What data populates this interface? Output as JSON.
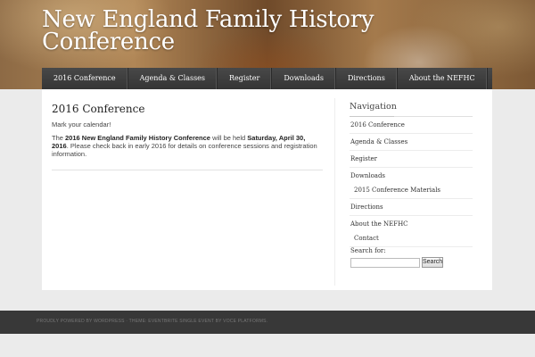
{
  "site": {
    "title": "New England Family History Conference"
  },
  "nav": {
    "items": [
      {
        "label": "2016 Conference"
      },
      {
        "label": "Agenda & Classes"
      },
      {
        "label": "Register"
      },
      {
        "label": "Downloads"
      },
      {
        "label": "Directions"
      },
      {
        "label": "About the NEFHC"
      }
    ]
  },
  "main": {
    "title": "2016 Conference",
    "intro": "Mark your calendar!",
    "para_pre": "The ",
    "para_bold1": "2016 New England Family History Conference",
    "para_mid": " will be held ",
    "para_bold2": "Saturday, April 30, 2016",
    "para_post": ". Please check back in early 2016 for details on conference sessions and registration information."
  },
  "sidebar": {
    "heading": "Navigation",
    "items": [
      {
        "label": "2016 Conference"
      },
      {
        "label": "Agenda & Classes"
      },
      {
        "label": "Register"
      },
      {
        "label": "Downloads"
      },
      {
        "label": "2015 Conference Materials"
      },
      {
        "label": "Directions"
      },
      {
        "label": "About the NEFHC"
      },
      {
        "label": "Contact"
      }
    ],
    "search_label": "Search for:",
    "search_button": "Search"
  },
  "footer": {
    "text": "PROUDLY POWERED BY WORDPRESS · THEME: EVENTBRITE SINGLE EVENT BY VOCE PLATFORMS."
  }
}
